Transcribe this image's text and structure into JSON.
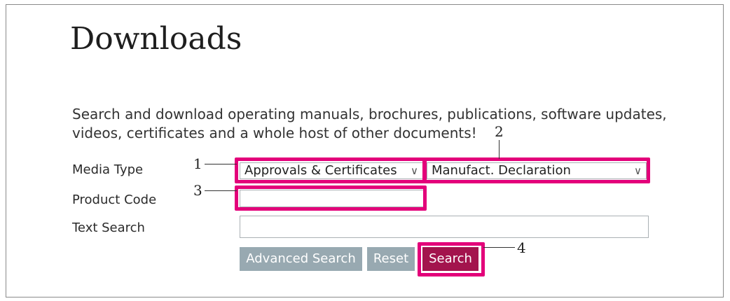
{
  "page": {
    "title": "Downloads"
  },
  "intro": {
    "line1": "Search and download operating manuals, brochures, publications, software updates,",
    "line2": "videos, certificates and a whole host of other documents!"
  },
  "form": {
    "media_type_label": "Media Type",
    "media_type_value": "Approvals & Certificates",
    "media_subtype_value": "Manufact. Declaration",
    "product_code_label": "Product Code",
    "product_code_value": "",
    "text_search_label": "Text Search",
    "text_search_value": ""
  },
  "buttons": {
    "advanced_search": "Advanced Search",
    "reset": "Reset",
    "search": "Search"
  },
  "callouts": {
    "c1": "1",
    "c2": "2",
    "c3": "3",
    "c4": "4"
  },
  "icons": {
    "dropdown": "chevron-down-icon"
  },
  "colors": {
    "highlight": "#e3007a",
    "search_button": "#a3144d",
    "gray_button": "#98a9b1"
  }
}
